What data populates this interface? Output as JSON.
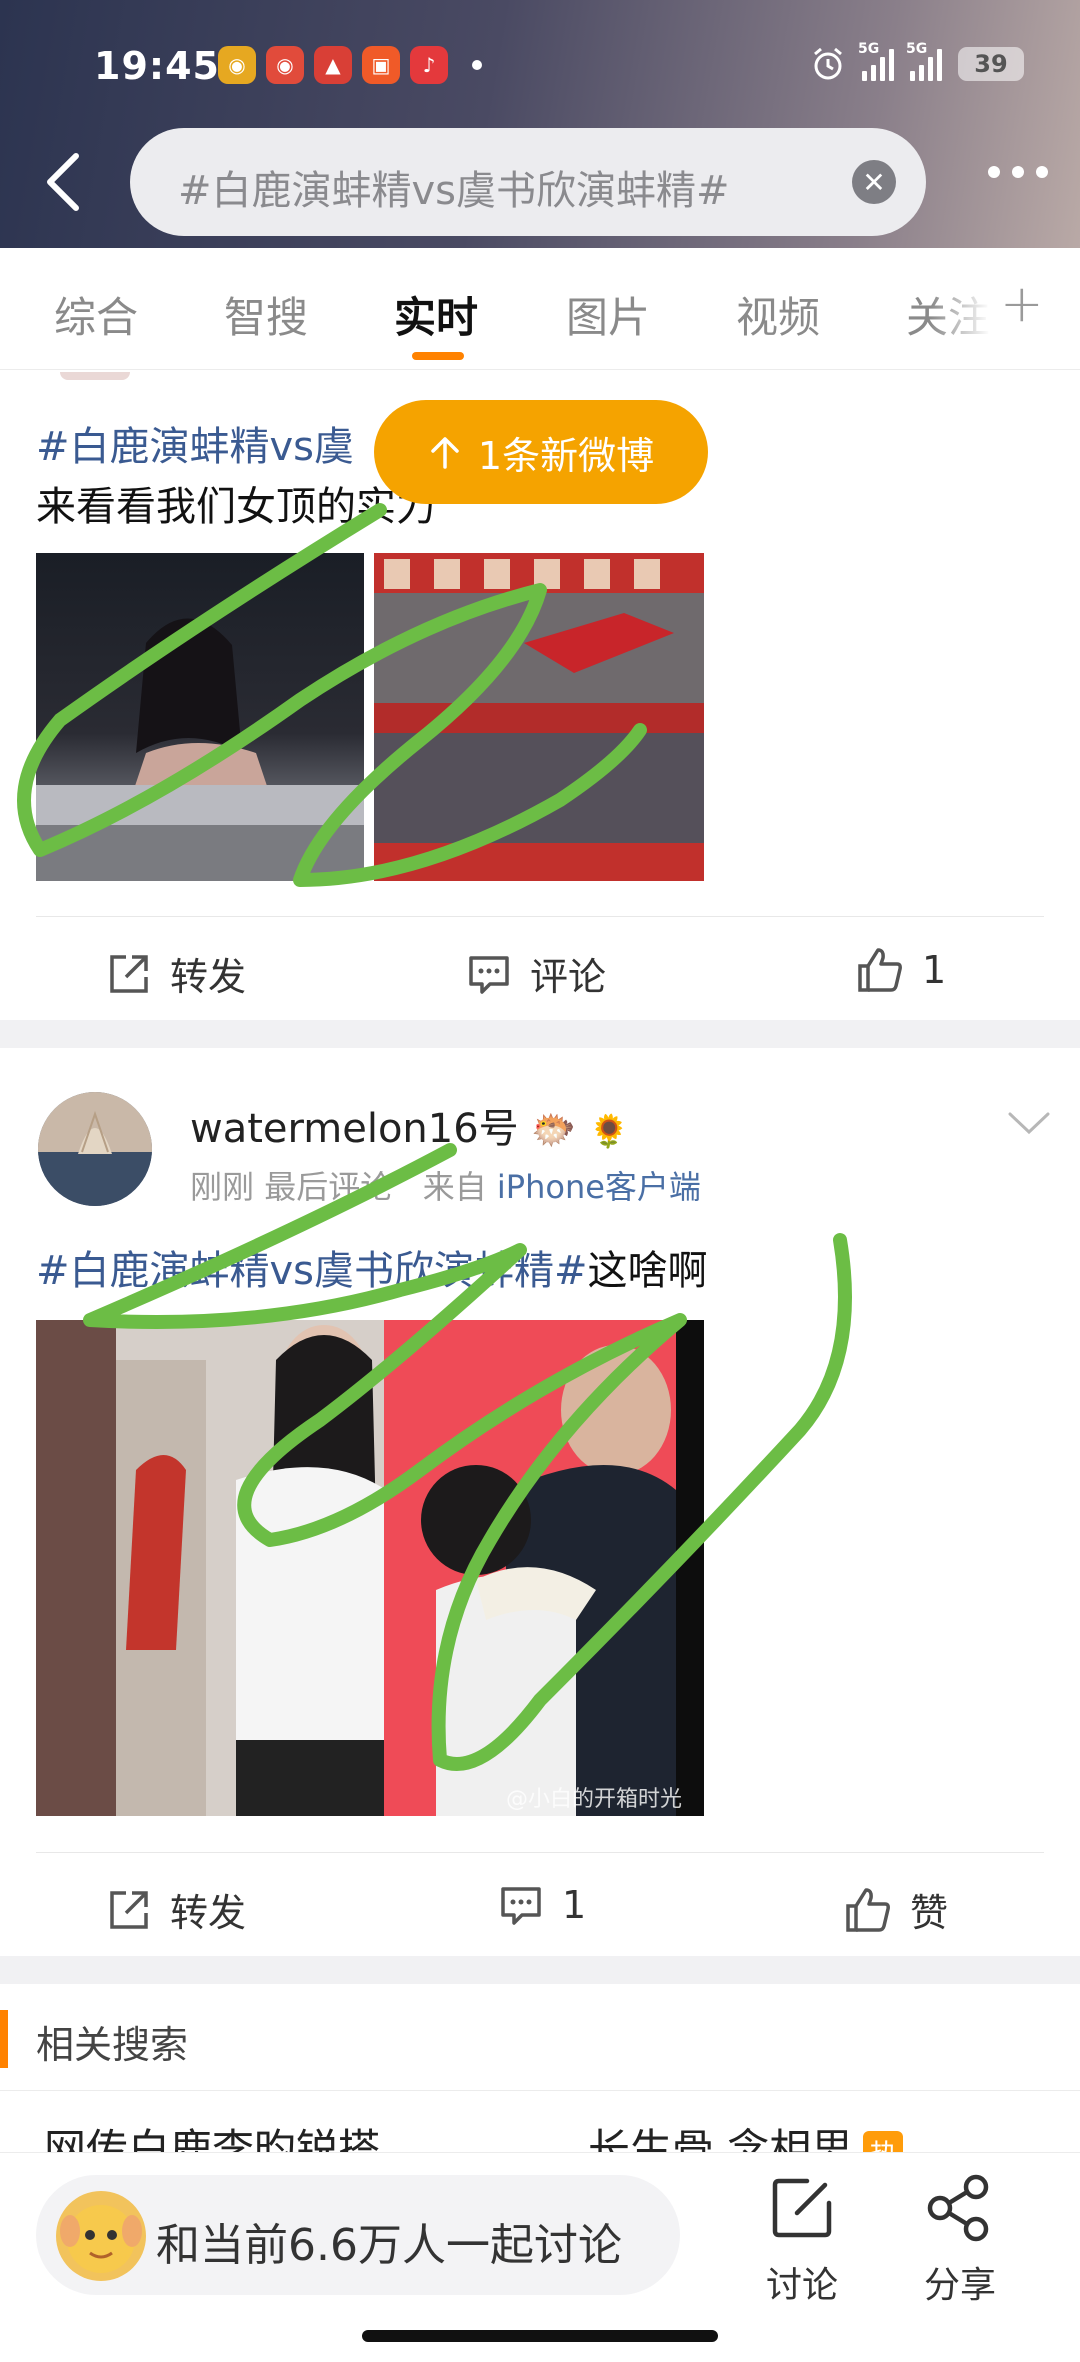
{
  "status_bar": {
    "time": "19:45",
    "battery": "39",
    "signal_labels": [
      "5G",
      "5G"
    ]
  },
  "search": {
    "query": "#白鹿演蚌精vs虞书欣演蚌精#"
  },
  "tabs": [
    {
      "label": "综合"
    },
    {
      "label": "智搜"
    },
    {
      "label": "实时",
      "active": true
    },
    {
      "label": "图片"
    },
    {
      "label": "视频"
    },
    {
      "label": "关注"
    }
  ],
  "new_posts_pill": "1条新微博",
  "post1": {
    "hashtag": "#白鹿演蚌精vs虞",
    "text": "来看看我们女顶的实力",
    "actions": {
      "repost": "转发",
      "comment": "评论",
      "like": "1"
    }
  },
  "post2": {
    "username": "watermelon16号",
    "time": "刚刚",
    "last_comment": "最后评论",
    "source_prefix": "来自",
    "source": "iPhone客户端",
    "hashtag": "#白鹿演蚌精vs虞书欣演蚌精#",
    "text": "这啥啊",
    "watermark": "@小白的开箱时光",
    "actions": {
      "repost": "转发",
      "comment": "1",
      "like": "赞"
    }
  },
  "related": {
    "title": "相关搜索",
    "items": [
      "网传白鹿李昀锐搭",
      "长生骨 念相思"
    ],
    "hot_badge": "热"
  },
  "bottom_bar": {
    "discuss": "和当前6.6万人一起讨论",
    "discuss_btn": "讨论",
    "share_btn": "分享"
  },
  "colors": {
    "accent": "#ff8200",
    "pill": "#f5a300",
    "hashtag": "#3a5a91",
    "scribble": "#6cbd45"
  }
}
